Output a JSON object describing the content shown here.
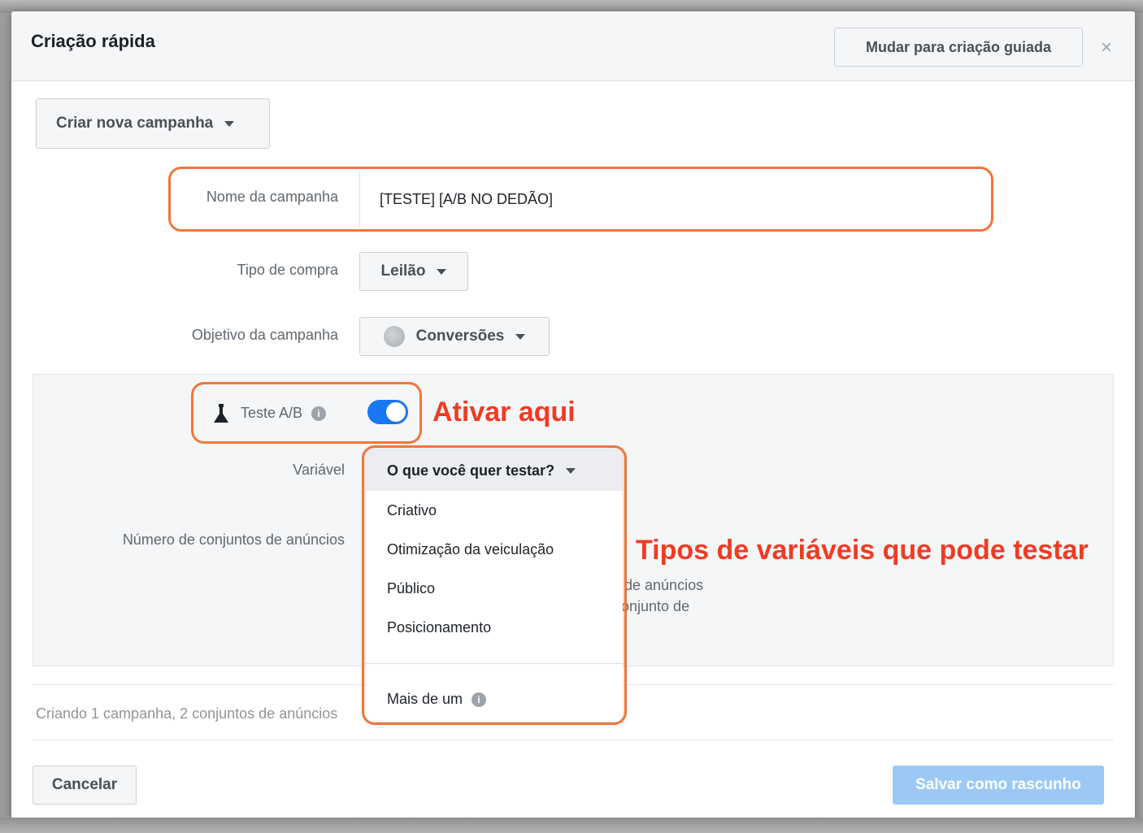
{
  "header": {
    "title": "Criação rápida",
    "guided_button": "Mudar para criação guiada",
    "close_icon": "×"
  },
  "campaign": {
    "selector_label": "Criar nova campanha",
    "name_label": "Nome da campanha",
    "name_value": "[TESTE] [A/B NO DEDÃO]",
    "purchase_label": "Tipo de compra",
    "purchase_value": "Leilão",
    "objective_label": "Objetivo da campanha",
    "objective_value": "Conversões"
  },
  "ab_test": {
    "label": "Teste A/B",
    "info_icon": "i",
    "toggle_on": true,
    "variable_label": "Variável",
    "adsets_label": "Número de conjuntos de anúncios",
    "hidden_text_1": "de anúncios",
    "hidden_text_2": "onjunto de"
  },
  "dropdown": {
    "placeholder": "O que você quer testar?",
    "options": [
      "Criativo",
      "Otimização da veiculação",
      "Público",
      "Posicionamento"
    ],
    "extra_option": "Mais de um"
  },
  "annotations": {
    "activate": "Ativar aqui",
    "types": "Tipos de variáveis que pode testar"
  },
  "footer": {
    "summary": "Criando 1 campanha, 2 conjuntos de anúncios",
    "cancel": "Cancelar",
    "save_draft": "Salvar como rascunho"
  },
  "colors": {
    "highlight": "#f0763b",
    "annotation": "#ef3b24",
    "toggle": "#1877f2",
    "primary_disabled": "#9cc9f4"
  }
}
